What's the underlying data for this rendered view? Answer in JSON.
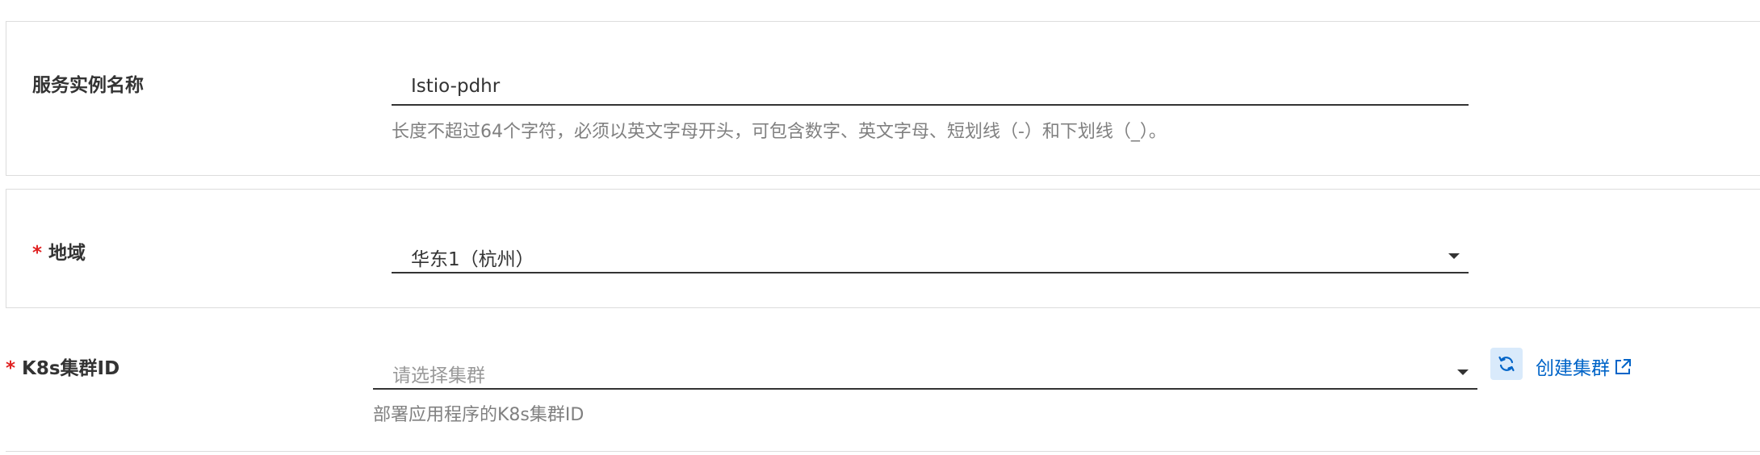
{
  "instance_name": {
    "label": "服务实例名称",
    "value": "Istio-pdhr",
    "help": "长度不超过64个字符，必须以英文字母开头，可包含数字、英文字母、短划线（-）和下划线（_）。"
  },
  "region": {
    "required_mark": "*",
    "label": "地域",
    "value": "华东1（杭州）",
    "icon": "chevron-down-icon"
  },
  "cluster": {
    "required_mark": "*",
    "label": "K8s集群ID",
    "placeholder": "请选择集群",
    "help": "部署应用程序的K8s集群ID",
    "refresh_icon": "refresh-icon",
    "create_link": "创建集群",
    "create_link_icon": "external-link-icon"
  },
  "colors": {
    "required": "#e02020",
    "link": "#0064c8",
    "refresh_bg": "#d9eafb"
  }
}
